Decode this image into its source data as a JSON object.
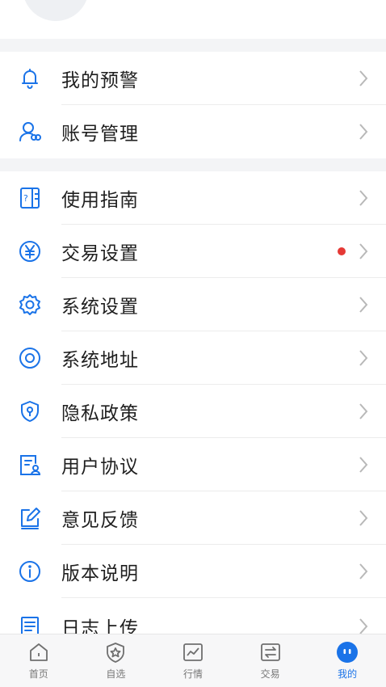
{
  "colors": {
    "accent": "#1a73e8",
    "badge": "#e53935",
    "text": "#1f1f1f",
    "muted": "#777777"
  },
  "section1": [
    {
      "label": "我的预警",
      "icon": "bell-icon"
    },
    {
      "label": "账号管理",
      "icon": "account-icon"
    }
  ],
  "section2": [
    {
      "label": "使用指南",
      "icon": "guide-icon"
    },
    {
      "label": "交易设置",
      "icon": "yen-icon"
    },
    {
      "label": "系统设置",
      "icon": "gear-icon"
    },
    {
      "label": "系统地址",
      "icon": "location-icon"
    },
    {
      "label": "隐私政策",
      "icon": "shield-icon"
    },
    {
      "label": "用户协议",
      "icon": "agreement-icon"
    },
    {
      "label": "意见反馈",
      "icon": "feedback-icon"
    },
    {
      "label": "版本说明",
      "icon": "info-icon"
    },
    {
      "label": "日志上传",
      "icon": "log-icon"
    }
  ],
  "tabbar": {
    "tabs": [
      {
        "label": "首页",
        "icon": "home-icon"
      },
      {
        "label": "自选",
        "icon": "favorite-icon"
      },
      {
        "label": "行情",
        "icon": "market-icon"
      },
      {
        "label": "交易",
        "icon": "trade-icon"
      },
      {
        "label": "我的",
        "icon": "profile-icon"
      }
    ],
    "active_index": 4
  }
}
